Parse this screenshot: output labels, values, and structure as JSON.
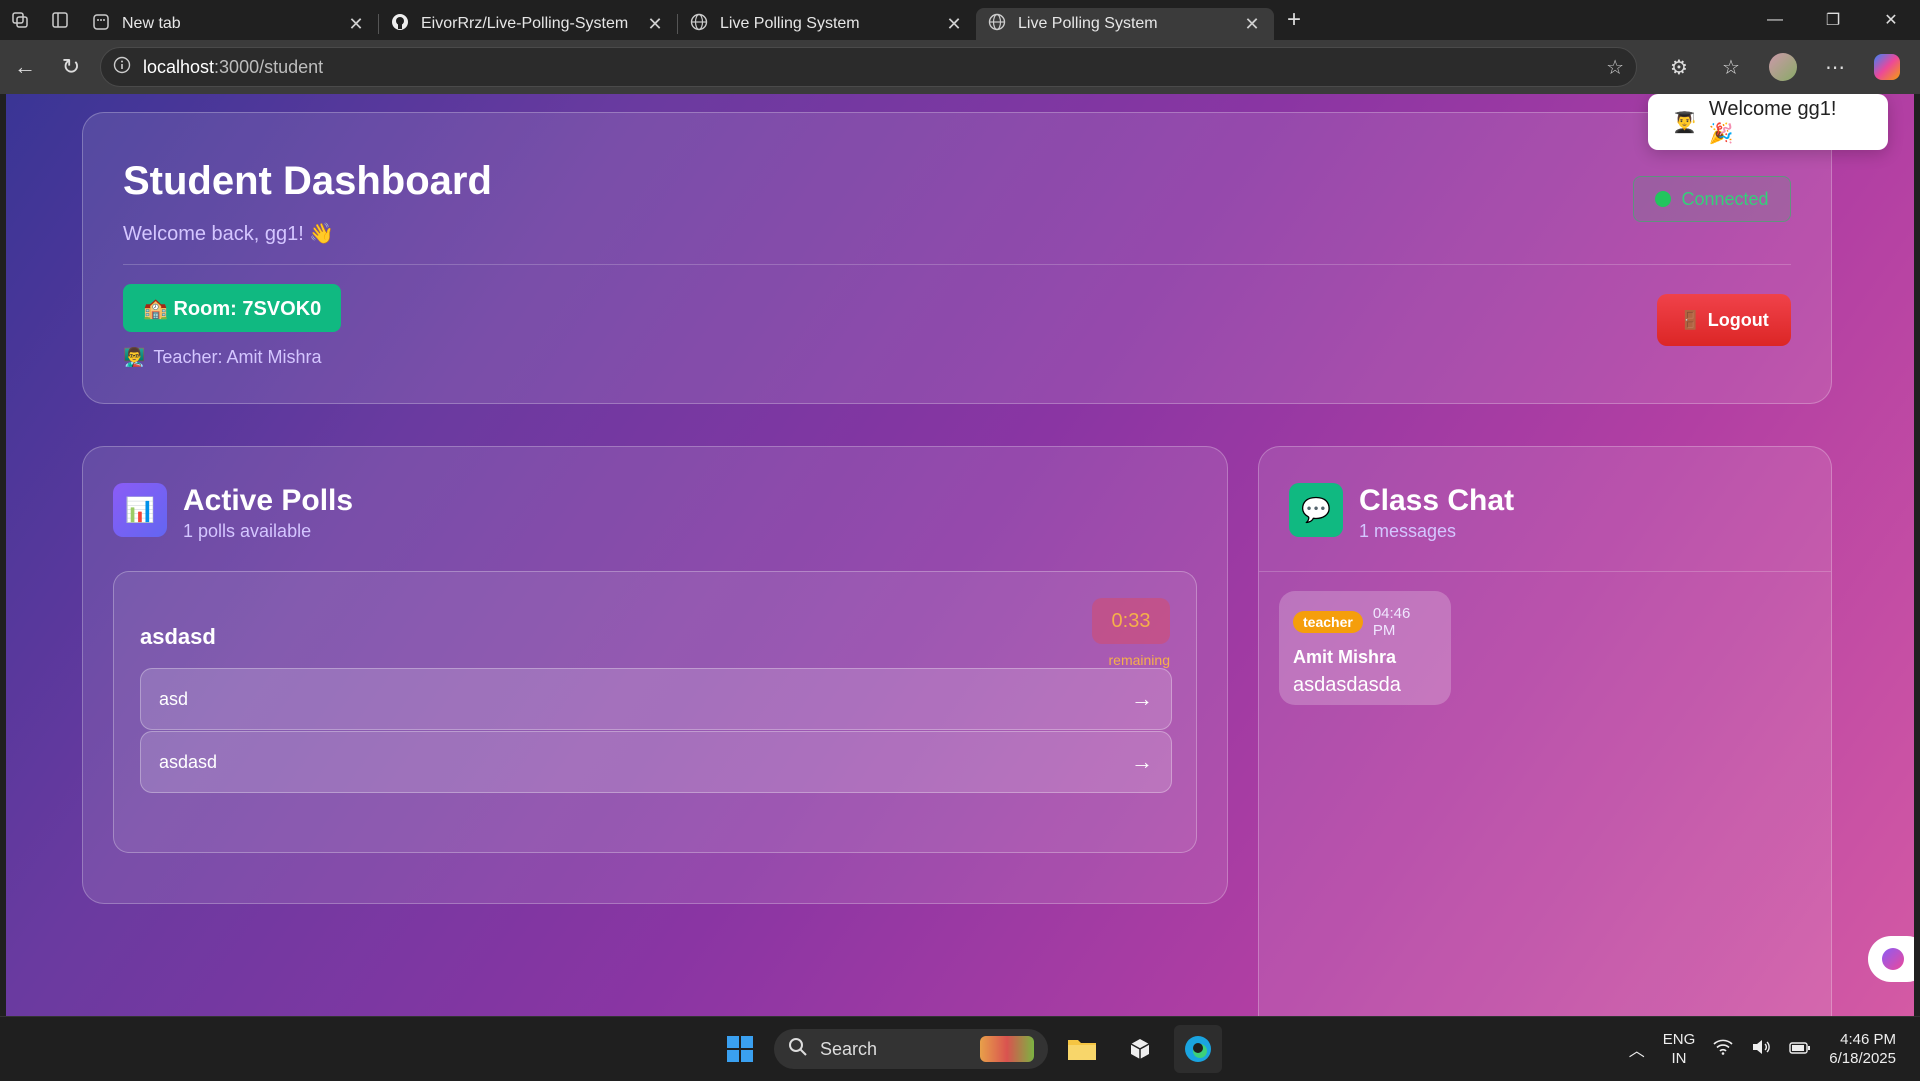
{
  "browser": {
    "tabs": [
      {
        "label": "New tab",
        "icon": "newtab-icon"
      },
      {
        "label": "EivorRrz/Live-Polling-System",
        "icon": "github-icon"
      },
      {
        "label": "Live Polling System",
        "icon": "globe-icon"
      },
      {
        "label": "Live Polling System",
        "icon": "globe-icon",
        "active": true
      }
    ],
    "url_host": "localhost",
    "url_path": ":3000/student"
  },
  "header": {
    "title": "Student Dashboard",
    "welcome": "Welcome back, gg1! 👋",
    "room": "🏫 Room: 7SVOK0",
    "teacher": "Teacher: Amit Mishra",
    "teacher_icon": "👨‍🏫",
    "status": "Connected",
    "logout": "Logout",
    "logout_icon": "🚪"
  },
  "toast": {
    "icon": "👨‍🎓",
    "text": "Welcome gg1! 🎉"
  },
  "polls": {
    "title": "Active Polls",
    "subtitle": "1 polls available",
    "icon": "📊",
    "items": [
      {
        "question": "asdasd",
        "timer": "0:33",
        "timer_label": "remaining",
        "options": [
          "asd",
          "asdasd"
        ]
      }
    ]
  },
  "chat": {
    "title": "Class Chat",
    "subtitle": "1 messages",
    "icon": "💬",
    "messages": [
      {
        "role": "teacher",
        "time": "04:46 PM",
        "name": "Amit Mishra",
        "text": "asdasdasda"
      }
    ]
  },
  "taskbar": {
    "search": "Search",
    "lang_top": "ENG",
    "lang_bottom": "IN",
    "time": "4:46 PM",
    "date": "6/18/2025"
  },
  "colors": {
    "accent_green": "#10b981",
    "logout_red": "#dc2626",
    "timer_amber": "#f5b04a",
    "badge_amber": "#f59e0b"
  }
}
